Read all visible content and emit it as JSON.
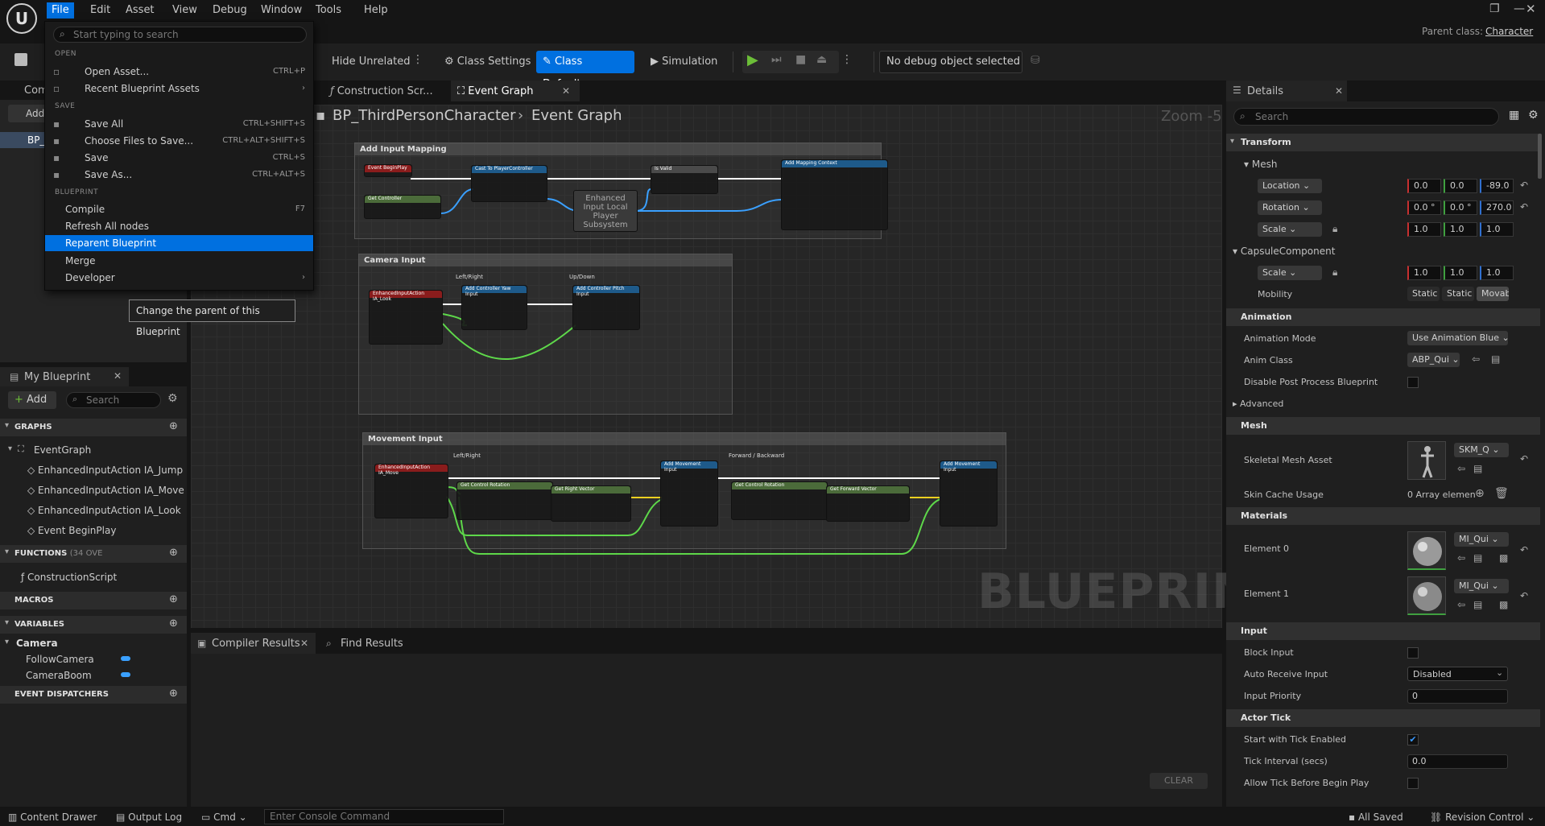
{
  "menubar": {
    "items": [
      "File",
      "Edit",
      "Asset",
      "View",
      "Debug",
      "Window",
      "Tools",
      "Help"
    ],
    "parent_class_label": "Parent class:",
    "parent_class_value": "Character"
  },
  "toolbar": {
    "hide_unrelated": "Hide Unrelated",
    "class_settings": "Class Settings",
    "class_defaults": "Class Defaults",
    "simulation": "Simulation",
    "debug_object": "No debug object selected"
  },
  "file_menu": {
    "search_placeholder": "Start typing to search",
    "open_header": "OPEN",
    "open_asset": "Open Asset...",
    "open_asset_sc": "CTRL+P",
    "recent": "Recent Blueprint Assets",
    "save_header": "SAVE",
    "save_all": "Save All",
    "save_all_sc": "CTRL+SHIFT+S",
    "choose": "Choose Files to Save...",
    "choose_sc": "CTRL+ALT+SHIFT+S",
    "save": "Save",
    "save_sc": "CTRL+S",
    "save_as": "Save As...",
    "save_as_sc": "CTRL+ALT+S",
    "bp_header": "BLUEPRINT",
    "compile": "Compile",
    "compile_sc": "F7",
    "refresh": "Refresh All nodes",
    "reparent": "Reparent Blueprint",
    "merge": "Merge",
    "developer": "Developer",
    "tooltip": "Change the parent of this Blueprint"
  },
  "left": {
    "components_tab": "Com",
    "add": "Add",
    "bp_item": "BP_",
    "my_blueprint": "My Blueprint",
    "add_btn": "Add",
    "search_placeholder": "Search",
    "graphs": "GRAPHS",
    "event_graph": "EventGraph",
    "graph_items": [
      "EnhancedInputAction IA_Jump",
      "EnhancedInputAction IA_Move",
      "EnhancedInputAction IA_Look",
      "Event BeginPlay"
    ],
    "functions": "FUNCTIONS",
    "functions_count": "(34 OVE",
    "construction_script": "ConstructionScript",
    "macros": "MACROS",
    "variables": "VARIABLES",
    "camera_cat": "Camera",
    "vars": [
      "FollowCamera",
      "CameraBoom"
    ],
    "dispatchers": "EVENT DISPATCHERS"
  },
  "center": {
    "tab_construction": "Construction Scr...",
    "tab_event": "Event Graph",
    "breadcrumb_bp": "BP_ThirdPersonCharacter",
    "breadcrumb_graph": "Event Graph",
    "zoom": "Zoom -5",
    "watermark": "BLUEPRINT",
    "comments": {
      "add_input": "Add Input Mapping",
      "camera": "Camera Input",
      "movement": "Movement Input",
      "leftright": "Left/Right",
      "updown": "Up/Down",
      "lr2": "Left/Right",
      "fb": "Forward / Backward"
    },
    "nodes": {
      "beginplay": "Event BeginPlay",
      "getcontroller": "Get Controller",
      "cast": "Cast To PlayerController",
      "isvalid": "Is Valid",
      "addmapping": "Add Mapping Context",
      "subsystem": "Enhanced Input Local Player Subsystem",
      "ia_look": "EnhancedInputAction IA_Look",
      "yaw": "Add Controller Yaw Input",
      "pitch": "Add Controller Pitch Input",
      "ia_move": "EnhancedInputAction IA_Move",
      "getrot": "Get Control Rotation",
      "rightvec": "Get Right Vector",
      "fwdvec": "Get Forward Vector",
      "addmove": "Add Movement Input",
      "addmove2": "Add Movement Input"
    }
  },
  "bottom": {
    "compiler_results": "Compiler Results",
    "find_results": "Find Results",
    "clear": "CLEAR"
  },
  "details": {
    "tab": "Details",
    "search_placeholder": "Search",
    "transform": "Transform",
    "mesh": "Mesh",
    "location": "Location",
    "loc": [
      "0.0",
      "0.0",
      "-89.0"
    ],
    "rotation": "Rotation",
    "rot": [
      "0.0 °",
      "0.0 °",
      "270.0"
    ],
    "scale": "Scale",
    "scl": [
      "1.0",
      "1.0",
      "1.0"
    ],
    "capsule": "CapsuleComponent",
    "cscale": "Scale",
    "cscl": [
      "1.0",
      "1.0",
      "1.0"
    ],
    "mobility": "Mobility",
    "mob": [
      "Static",
      "Static",
      "Movable"
    ],
    "animation": "Animation",
    "anim_mode": "Animation Mode",
    "anim_mode_val": "Use Animation Blue",
    "anim_class": "Anim Class",
    "anim_class_val": "ABP_Qui",
    "disable_pp": "Disable Post Process Blueprint",
    "advanced": "Advanced",
    "mesh2": "Mesh",
    "skel": "Skeletal Mesh Asset",
    "skel_val": "SKM_Q",
    "skin_cache": "Skin Cache Usage",
    "skin_cache_val": "0 Array elemen",
    "materials": "Materials",
    "el0": "Element 0",
    "el0_val": "MI_Qui",
    "el1": "Element 1",
    "el1_val": "MI_Qui",
    "input": "Input",
    "block_input": "Block Input",
    "auto_receive": "Auto Receive Input",
    "auto_receive_val": "Disabled",
    "input_priority": "Input Priority",
    "input_priority_val": "0",
    "actor_tick": "Actor Tick",
    "start_tick": "Start with Tick Enabled",
    "tick_interval": "Tick Interval (secs)",
    "tick_interval_val": "0.0",
    "allow_tick": "Allow Tick Before Begin Play"
  },
  "status": {
    "content_drawer": "Content Drawer",
    "output_log": "Output Log",
    "cmd": "Cmd",
    "console_placeholder": "Enter Console Command",
    "all_saved": "All Saved",
    "revision": "Revision Control"
  },
  "colors": {
    "accent": "#0070e0",
    "exec": "#ffffff",
    "object": "#3aa0ff",
    "vector": "#f0d020",
    "float": "#5ed84a"
  }
}
